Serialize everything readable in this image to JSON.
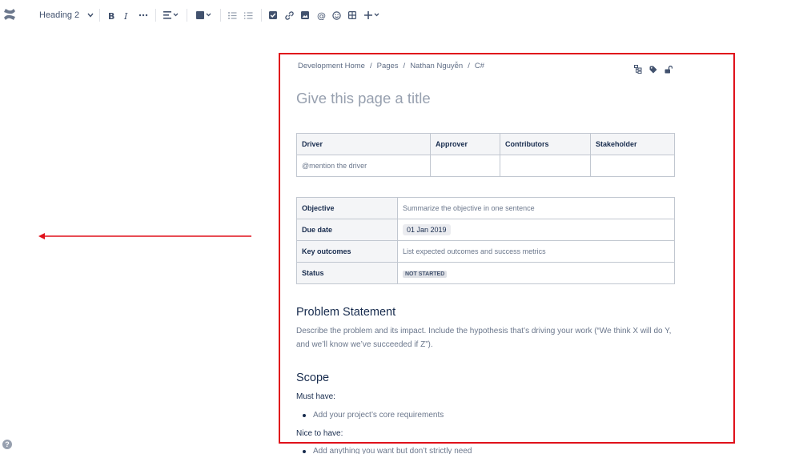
{
  "toolbar": {
    "heading_style": "Heading 2"
  },
  "breadcrumb": [
    "Development Home",
    "Pages",
    "Nathan Nguyễn",
    "C#"
  ],
  "title_placeholder": "Give this page a title",
  "roles_table": {
    "headers": [
      "Driver",
      "Approver",
      "Contributors",
      "Stakeholder"
    ],
    "row": [
      "@mention the driver",
      "",
      "",
      ""
    ]
  },
  "details_table": {
    "objective_label": "Objective",
    "objective_value": "Summarize the objective in one sentence",
    "due_label": "Due date",
    "due_value": "01 Jan 2019",
    "outcomes_label": "Key outcomes",
    "outcomes_value": "List expected outcomes and success metrics",
    "status_label": "Status",
    "status_value": "NOT STARTED"
  },
  "problem": {
    "heading": "Problem Statement",
    "line1": "Describe the problem and its impact. Include the hypothesis that’s driving your work (“We think X will do Y,",
    "line2": "and we’ll know we’ve succeeded if Z”)."
  },
  "scope": {
    "heading": "Scope",
    "must_label": "Must have:",
    "must_item": "Add your project’s core requirements",
    "nice_label": "Nice to have:",
    "nice_item": "Add anything you want but don’t strictly need"
  },
  "help_glyph": "?",
  "colors": {
    "highlight": "#e0111b",
    "arrow": "#e0111b",
    "text": "#172b4d",
    "muted": "#6b778c"
  }
}
